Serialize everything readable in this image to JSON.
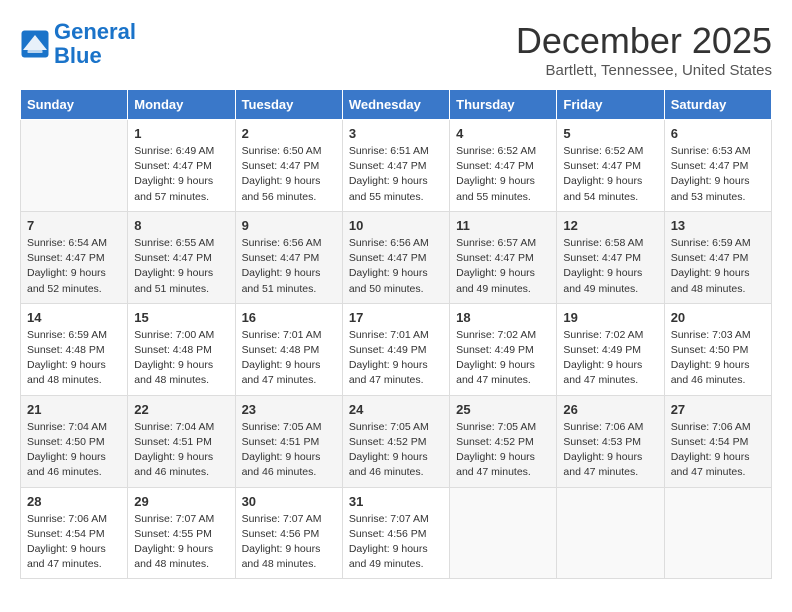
{
  "header": {
    "logo_line1": "General",
    "logo_line2": "Blue",
    "month": "December 2025",
    "location": "Bartlett, Tennessee, United States"
  },
  "weekdays": [
    "Sunday",
    "Monday",
    "Tuesday",
    "Wednesday",
    "Thursday",
    "Friday",
    "Saturday"
  ],
  "weeks": [
    [
      {
        "day": "",
        "info": ""
      },
      {
        "day": "1",
        "info": "Sunrise: 6:49 AM\nSunset: 4:47 PM\nDaylight: 9 hours\nand 57 minutes."
      },
      {
        "day": "2",
        "info": "Sunrise: 6:50 AM\nSunset: 4:47 PM\nDaylight: 9 hours\nand 56 minutes."
      },
      {
        "day": "3",
        "info": "Sunrise: 6:51 AM\nSunset: 4:47 PM\nDaylight: 9 hours\nand 55 minutes."
      },
      {
        "day": "4",
        "info": "Sunrise: 6:52 AM\nSunset: 4:47 PM\nDaylight: 9 hours\nand 55 minutes."
      },
      {
        "day": "5",
        "info": "Sunrise: 6:52 AM\nSunset: 4:47 PM\nDaylight: 9 hours\nand 54 minutes."
      },
      {
        "day": "6",
        "info": "Sunrise: 6:53 AM\nSunset: 4:47 PM\nDaylight: 9 hours\nand 53 minutes."
      }
    ],
    [
      {
        "day": "7",
        "info": "Sunrise: 6:54 AM\nSunset: 4:47 PM\nDaylight: 9 hours\nand 52 minutes."
      },
      {
        "day": "8",
        "info": "Sunrise: 6:55 AM\nSunset: 4:47 PM\nDaylight: 9 hours\nand 51 minutes."
      },
      {
        "day": "9",
        "info": "Sunrise: 6:56 AM\nSunset: 4:47 PM\nDaylight: 9 hours\nand 51 minutes."
      },
      {
        "day": "10",
        "info": "Sunrise: 6:56 AM\nSunset: 4:47 PM\nDaylight: 9 hours\nand 50 minutes."
      },
      {
        "day": "11",
        "info": "Sunrise: 6:57 AM\nSunset: 4:47 PM\nDaylight: 9 hours\nand 49 minutes."
      },
      {
        "day": "12",
        "info": "Sunrise: 6:58 AM\nSunset: 4:47 PM\nDaylight: 9 hours\nand 49 minutes."
      },
      {
        "day": "13",
        "info": "Sunrise: 6:59 AM\nSunset: 4:47 PM\nDaylight: 9 hours\nand 48 minutes."
      }
    ],
    [
      {
        "day": "14",
        "info": "Sunrise: 6:59 AM\nSunset: 4:48 PM\nDaylight: 9 hours\nand 48 minutes."
      },
      {
        "day": "15",
        "info": "Sunrise: 7:00 AM\nSunset: 4:48 PM\nDaylight: 9 hours\nand 48 minutes."
      },
      {
        "day": "16",
        "info": "Sunrise: 7:01 AM\nSunset: 4:48 PM\nDaylight: 9 hours\nand 47 minutes."
      },
      {
        "day": "17",
        "info": "Sunrise: 7:01 AM\nSunset: 4:49 PM\nDaylight: 9 hours\nand 47 minutes."
      },
      {
        "day": "18",
        "info": "Sunrise: 7:02 AM\nSunset: 4:49 PM\nDaylight: 9 hours\nand 47 minutes."
      },
      {
        "day": "19",
        "info": "Sunrise: 7:02 AM\nSunset: 4:49 PM\nDaylight: 9 hours\nand 47 minutes."
      },
      {
        "day": "20",
        "info": "Sunrise: 7:03 AM\nSunset: 4:50 PM\nDaylight: 9 hours\nand 46 minutes."
      }
    ],
    [
      {
        "day": "21",
        "info": "Sunrise: 7:04 AM\nSunset: 4:50 PM\nDaylight: 9 hours\nand 46 minutes."
      },
      {
        "day": "22",
        "info": "Sunrise: 7:04 AM\nSunset: 4:51 PM\nDaylight: 9 hours\nand 46 minutes."
      },
      {
        "day": "23",
        "info": "Sunrise: 7:05 AM\nSunset: 4:51 PM\nDaylight: 9 hours\nand 46 minutes."
      },
      {
        "day": "24",
        "info": "Sunrise: 7:05 AM\nSunset: 4:52 PM\nDaylight: 9 hours\nand 46 minutes."
      },
      {
        "day": "25",
        "info": "Sunrise: 7:05 AM\nSunset: 4:52 PM\nDaylight: 9 hours\nand 47 minutes."
      },
      {
        "day": "26",
        "info": "Sunrise: 7:06 AM\nSunset: 4:53 PM\nDaylight: 9 hours\nand 47 minutes."
      },
      {
        "day": "27",
        "info": "Sunrise: 7:06 AM\nSunset: 4:54 PM\nDaylight: 9 hours\nand 47 minutes."
      }
    ],
    [
      {
        "day": "28",
        "info": "Sunrise: 7:06 AM\nSunset: 4:54 PM\nDaylight: 9 hours\nand 47 minutes."
      },
      {
        "day": "29",
        "info": "Sunrise: 7:07 AM\nSunset: 4:55 PM\nDaylight: 9 hours\nand 48 minutes."
      },
      {
        "day": "30",
        "info": "Sunrise: 7:07 AM\nSunset: 4:56 PM\nDaylight: 9 hours\nand 48 minutes."
      },
      {
        "day": "31",
        "info": "Sunrise: 7:07 AM\nSunset: 4:56 PM\nDaylight: 9 hours\nand 49 minutes."
      },
      {
        "day": "",
        "info": ""
      },
      {
        "day": "",
        "info": ""
      },
      {
        "day": "",
        "info": ""
      }
    ]
  ]
}
